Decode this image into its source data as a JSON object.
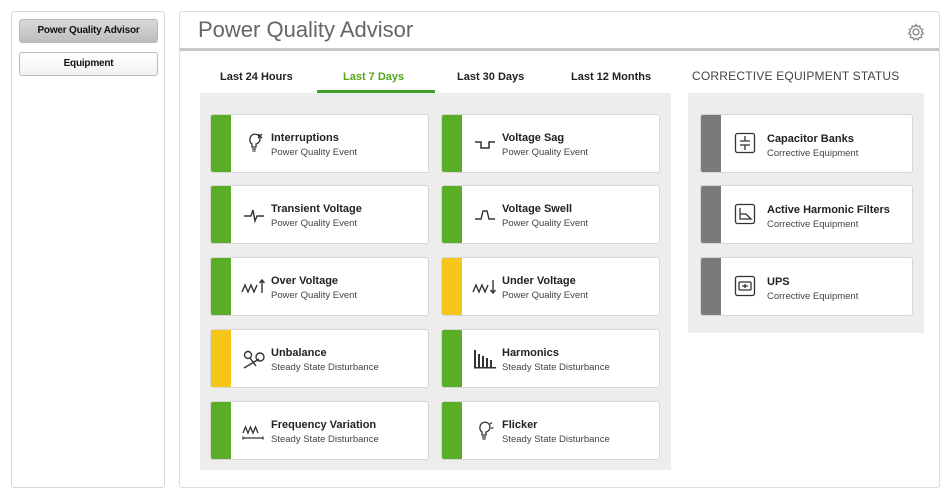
{
  "sidebar": {
    "items": [
      {
        "label": "Power Quality Advisor",
        "active": true
      },
      {
        "label": "Equipment",
        "active": false
      }
    ]
  },
  "header": {
    "title": "Power Quality Advisor",
    "settings_icon": "gear-icon"
  },
  "tabs": [
    {
      "label": "Last 24 Hours",
      "active": false
    },
    {
      "label": "Last 7 Days",
      "active": true
    },
    {
      "label": "Last 30 Days",
      "active": false
    },
    {
      "label": "Last 12 Months",
      "active": false
    }
  ],
  "colors": {
    "green": "#5aad26",
    "yellow": "#f5c518",
    "gray": "#7a7a7a",
    "accent": "#3ca02a"
  },
  "events": [
    {
      "name": "Interruptions",
      "sub": "Power Quality Event",
      "status": "green",
      "icon": "bulb-x-icon"
    },
    {
      "name": "Voltage Sag",
      "sub": "Power Quality Event",
      "status": "green",
      "icon": "voltage-sag-icon"
    },
    {
      "name": "Transient Voltage",
      "sub": "Power Quality Event",
      "status": "green",
      "icon": "transient-icon"
    },
    {
      "name": "Voltage Swell",
      "sub": "Power Quality Event",
      "status": "green",
      "icon": "voltage-swell-icon"
    },
    {
      "name": "Over Voltage",
      "sub": "Power Quality Event",
      "status": "green",
      "icon": "over-voltage-icon"
    },
    {
      "name": "Under Voltage",
      "sub": "Power Quality Event",
      "status": "yellow",
      "icon": "under-voltage-icon"
    },
    {
      "name": "Unbalance",
      "sub": "Steady State Disturbance",
      "status": "yellow",
      "icon": "unbalance-icon"
    },
    {
      "name": "Harmonics",
      "sub": "Steady State Disturbance",
      "status": "green",
      "icon": "harmonics-icon"
    },
    {
      "name": "Frequency Variation",
      "sub": "Steady State Disturbance",
      "status": "green",
      "icon": "frequency-icon"
    },
    {
      "name": "Flicker",
      "sub": "Steady State Disturbance",
      "status": "green",
      "icon": "flicker-icon"
    }
  ],
  "corrective": {
    "heading": "CORRECTIVE EQUIPMENT STATUS",
    "items": [
      {
        "name": "Capacitor Banks",
        "sub": "Corrective Equipment",
        "status": "gray",
        "icon": "capacitor-icon"
      },
      {
        "name": "Active Harmonic Filters",
        "sub": "Corrective Equipment",
        "status": "gray",
        "icon": "filter-icon"
      },
      {
        "name": "UPS",
        "sub": "Corrective Equipment",
        "status": "gray",
        "icon": "ups-icon"
      }
    ]
  }
}
